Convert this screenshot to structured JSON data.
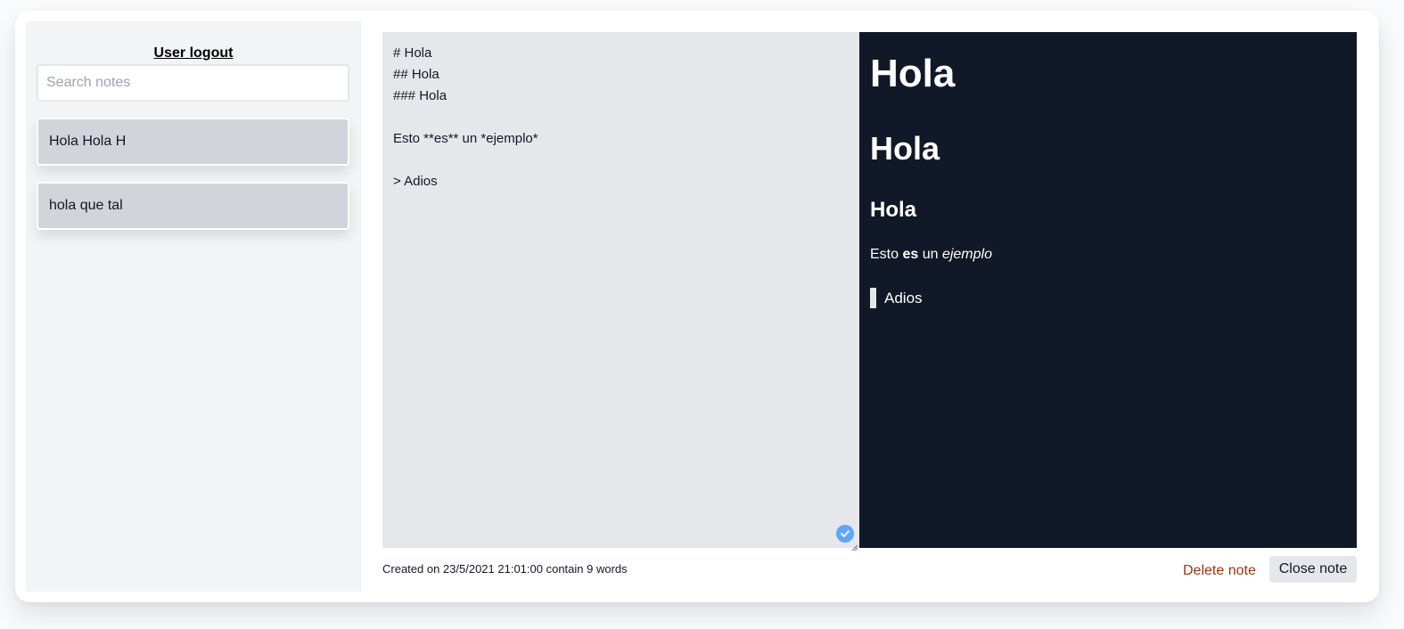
{
  "sidebar": {
    "logout_label": "User logout",
    "search_placeholder": "Search notes",
    "notes": [
      {
        "title": "Hola Hola H"
      },
      {
        "title": "hola que tal"
      }
    ]
  },
  "editor": {
    "content": "# Hola\n## Hola\n### Hola\n\nEsto **es** un *ejemplo*\n\n> Adios",
    "saved_icon": "check-circle-icon"
  },
  "preview": {
    "h1": "Hola",
    "h2": "Hola",
    "h3": "Hola",
    "para_before": "Esto ",
    "para_bold": "es",
    "para_mid": " un ",
    "para_italic": "ejemplo",
    "blockquote": "Adios"
  },
  "footer": {
    "info": "Created on 23/5/2021 21:01:00 contain 9 words",
    "delete_label": "Delete note",
    "close_label": "Close note"
  },
  "colors": {
    "preview_bg": "#111827",
    "editor_bg": "#e5e7eb",
    "sidebar_bg": "#f3f4f6",
    "delete_text": "#9a3412",
    "check_icon": "#60a5fa"
  }
}
